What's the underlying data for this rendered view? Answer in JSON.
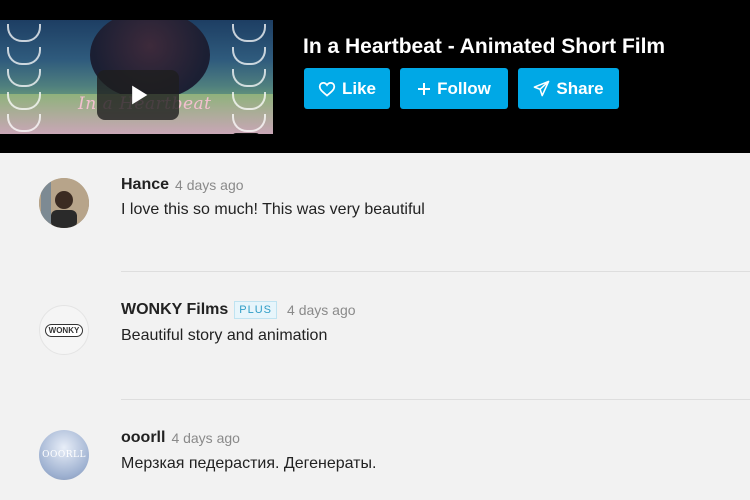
{
  "video": {
    "title": "In a Heartbeat - Animated Short Film",
    "thumbnail_text": "In a Heartbeat"
  },
  "actions": {
    "like_label": "Like",
    "follow_label": "Follow",
    "share_label": "Share",
    "accent_color": "#00a8e6"
  },
  "comments": [
    {
      "author": "Hance",
      "badge": "",
      "date": "4 days ago",
      "text": "I love this so much! This was very beautiful"
    },
    {
      "author": "WONKY Films",
      "badge": "PLUS",
      "date": "4 days ago",
      "text": "Beautiful story and animation",
      "avatar_text": "WONKY"
    },
    {
      "author": "ooorll",
      "badge": "",
      "date": "4 days ago",
      "text": "Мерзкая педерастия. Дегенераты.",
      "avatar_text": "OOORLL"
    }
  ]
}
